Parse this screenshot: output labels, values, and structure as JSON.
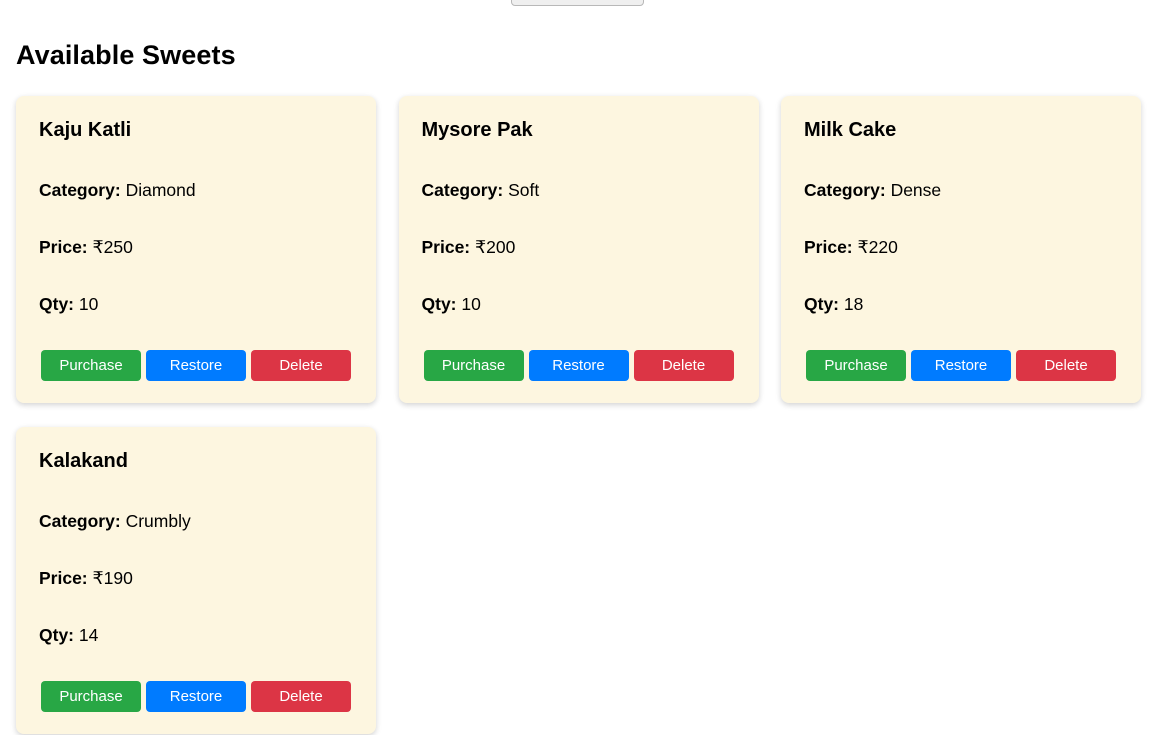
{
  "page": {
    "title": "Available Sweets"
  },
  "labels": {
    "category": "Category:",
    "price": "Price:",
    "qty": "Qty:"
  },
  "buttons": {
    "purchase": "Purchase",
    "restore": "Restore",
    "delete": "Delete"
  },
  "colors": {
    "card_background": "#fdf6e0",
    "purchase": "#28a745",
    "restore": "#007bff",
    "delete": "#dc3545"
  },
  "sweets": [
    {
      "name": "Kaju Katli",
      "category": "Diamond",
      "price": "₹250",
      "qty": "10"
    },
    {
      "name": "Mysore Pak",
      "category": "Soft",
      "price": "₹200",
      "qty": "10"
    },
    {
      "name": "Milk Cake",
      "category": "Dense",
      "price": "₹220",
      "qty": "18"
    },
    {
      "name": "Kalakand",
      "category": "Crumbly",
      "price": "₹190",
      "qty": "14"
    }
  ]
}
